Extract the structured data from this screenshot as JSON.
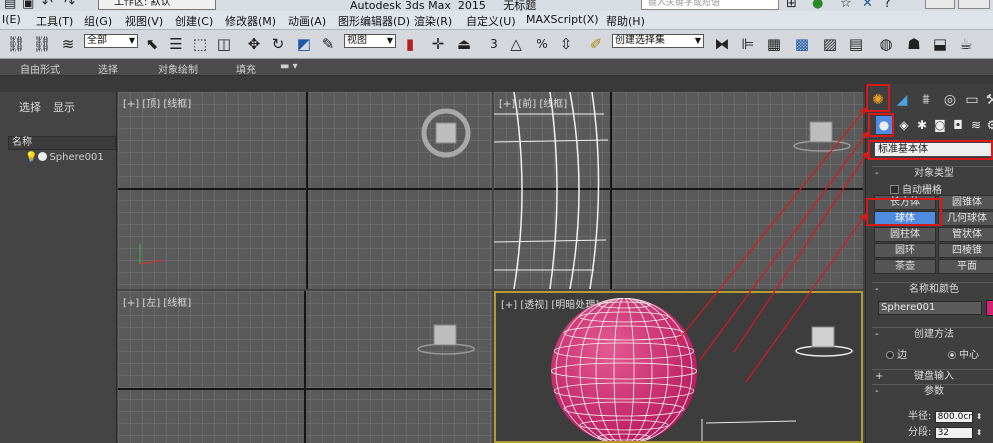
{
  "titlebar": {
    "workspace": "工作区: 默认",
    "app_title": "Autodesk 3ds Max  2015     无标题",
    "search_placeholder": "键入关键字或短语"
  },
  "menu": [
    "I(E)",
    "工具(T)",
    "组(G)",
    "视图(V)",
    "创建(C)",
    "修改器(M)",
    "动画(A)",
    "图形编辑器(D)",
    "渲染(R)",
    "自定义(U)",
    "MAXScript(X)",
    "帮助(H)"
  ],
  "toolbar": {
    "selection_filter": "全部",
    "ref_coord": "视图",
    "snap_3": "3",
    "percent": "%",
    "selection_set": "创建选择集"
  },
  "ribbon": [
    "自由形式",
    "选择",
    "对象绘制",
    "填充"
  ],
  "explorer": {
    "tab_select": "选择",
    "tab_display": "显示",
    "column_name": "名称",
    "object_name": "Sphere001"
  },
  "viewports": {
    "top": "[+] [顶] [线框]",
    "front": "[+] [前] [线框]",
    "left": "[+] [左] [线框]",
    "perspective": "[+] [透视] [明暗处理]"
  },
  "command_panel": {
    "category": "标准基本体",
    "object_type_title": "对象类型",
    "auto_grid": "自动栅格",
    "primitives": [
      "长方体",
      "圆锥体",
      "球体",
      "几何球体",
      "圆柱体",
      "管状体",
      "圆环",
      "四棱锥",
      "茶壶",
      "平面"
    ],
    "active_primitive": "球体",
    "name_color_title": "名称和颜色",
    "name_value": "Sphere001",
    "object_color": "#d6246e",
    "creation_method_title": "创建方法",
    "method_edge": "边",
    "method_center": "中心",
    "method_selected": "中心",
    "keyboard_title": "键盘输入",
    "params_title": "参数",
    "radius_label": "半径:",
    "radius_value": "800.0cm",
    "segments_label": "分段:",
    "segments_value": "32"
  },
  "colors": {
    "sphere": "#d6246e",
    "annotation": "#d81a1a",
    "active_button": "#4f8be0",
    "viewport_border_active": "#b59b34"
  }
}
